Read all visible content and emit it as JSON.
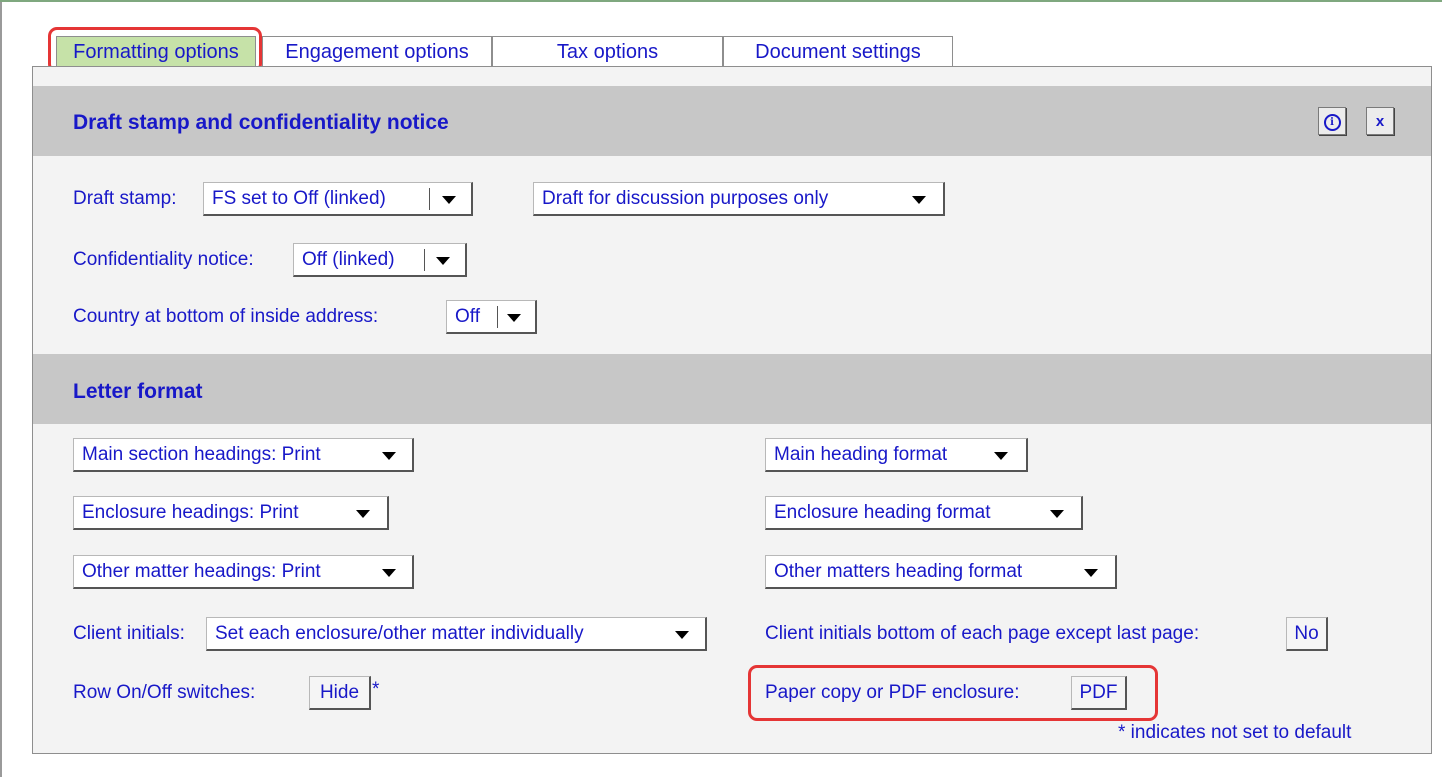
{
  "tabs": [
    {
      "label": "Formatting options",
      "active": true
    },
    {
      "label": "Engagement options",
      "active": false
    },
    {
      "label": "Tax options",
      "active": false
    },
    {
      "label": "Document settings",
      "active": false
    }
  ],
  "sections": {
    "draft": {
      "title": "Draft stamp and confidentiality notice"
    },
    "letter": {
      "title": "Letter format"
    }
  },
  "header_buttons": {
    "info_icon": "info-icon",
    "close_label": "x"
  },
  "draft": {
    "draft_stamp_label": "Draft stamp:",
    "draft_stamp_value": "FS set to Off (linked)",
    "draft_text_value": "Draft for discussion purposes only",
    "confidentiality_label": "Confidentiality notice:",
    "confidentiality_value": "Off (linked)",
    "country_label": "Country at bottom of inside address:",
    "country_value": "Off"
  },
  "letter": {
    "main_section_headings": "Main section headings: Print",
    "main_heading_format": "Main heading format",
    "enclosure_headings": "Enclosure headings: Print",
    "enclosure_heading_format": "Enclosure heading format",
    "other_matter_headings": "Other matter headings: Print",
    "other_matters_heading_format": "Other matters heading format",
    "client_initials_label": "Client initials:",
    "client_initials_value": "Set each enclosure/other matter individually",
    "client_initials_bottom_label": "Client initials bottom of each page except last page:",
    "client_initials_bottom_value": "No",
    "row_switches_label": "Row On/Off switches:",
    "row_switches_value": "Hide",
    "row_switches_marker": "*",
    "paper_pdf_label": "Paper copy or PDF enclosure:",
    "paper_pdf_value": "PDF"
  },
  "footnote": "* indicates not set to default",
  "colors": {
    "text": "#1818c8",
    "active_tab": "#c6e2a8",
    "section_header": "#c7c7c7",
    "highlight": "#e53535"
  }
}
